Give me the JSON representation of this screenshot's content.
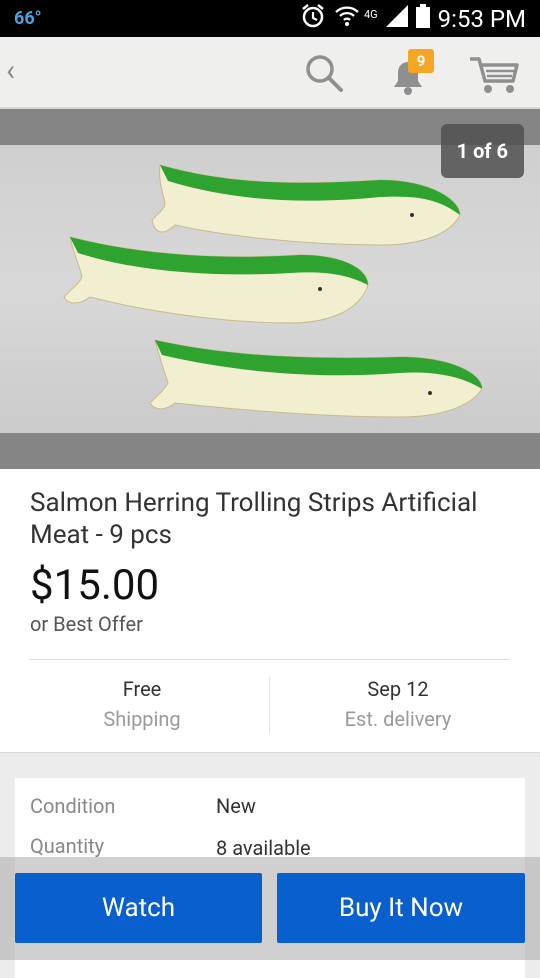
{
  "status_bar": {
    "temperature": "66°",
    "network": "4G",
    "time": "9:53 PM"
  },
  "top_bar": {
    "back_label": "‹",
    "notification_count": "9"
  },
  "gallery": {
    "counter": "1 of 6"
  },
  "item": {
    "title": "Salmon Herring Trolling Strips Artificial Meat - 9 pcs",
    "price": "$15.00",
    "offer_note": "or Best Offer"
  },
  "shipping": {
    "value": "Free",
    "label": "Shipping"
  },
  "delivery": {
    "value": "Sep 12",
    "label": "Est. delivery"
  },
  "details": [
    {
      "key": "Condition",
      "value": "New"
    },
    {
      "key": "Quantity",
      "value": "8 available"
    }
  ],
  "actions": {
    "watch_label": "Watch",
    "buy_label": "Buy It Now"
  },
  "colors": {
    "accent": "#0a5fcf",
    "badge": "#f5a623",
    "fish_green": "#2fa32f"
  }
}
